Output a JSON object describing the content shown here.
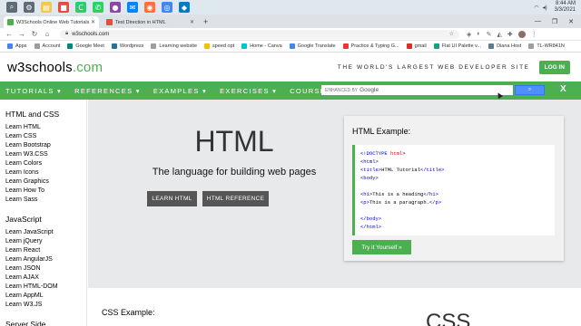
{
  "taskbar": {
    "apps": [
      {
        "icon": "search-icon",
        "color": "#5f6b76",
        "glyph": "⌕"
      },
      {
        "icon": "settings-icon",
        "color": "#5f6b76",
        "glyph": "⚙"
      },
      {
        "icon": "file-explorer-icon",
        "color": "#f2c94c",
        "glyph": "▤"
      },
      {
        "icon": "app-red-icon",
        "color": "#e74c3c",
        "glyph": "■"
      },
      {
        "icon": "app-green-icon",
        "color": "#2ecc71",
        "glyph": "C"
      },
      {
        "icon": "whatsapp-icon",
        "color": "#25d366",
        "glyph": "✆"
      },
      {
        "icon": "app-purple-icon",
        "color": "#8e44ad",
        "glyph": "●"
      },
      {
        "icon": "messenger-icon",
        "color": "#0084ff",
        "glyph": "✉"
      },
      {
        "icon": "firefox-icon",
        "color": "#ff7139",
        "glyph": "◉"
      },
      {
        "icon": "chrome-icon",
        "color": "#4285f4",
        "glyph": "◎"
      },
      {
        "icon": "vscode-icon",
        "color": "#007acc",
        "glyph": "◆"
      }
    ],
    "time": "8:44 AM",
    "date": "3/3/2021"
  },
  "browser": {
    "tabs": [
      {
        "title": "W3Schools Online Web Tutorials",
        "active": true,
        "favicon_color": "#4CAF50"
      },
      {
        "title": "Test Direction in HTML",
        "active": false,
        "favicon_color": "#e74c3c"
      }
    ],
    "new_tab": "+",
    "url": "w3schools.com",
    "bookmarks": [
      {
        "label": "Apps",
        "color": "#4285f4"
      },
      {
        "label": "Account",
        "color": "#9e9e9e"
      },
      {
        "label": "Google Meet",
        "color": "#00897b"
      },
      {
        "label": "Wordpress",
        "color": "#21759b"
      },
      {
        "label": "Learning website",
        "color": "#9e9e9e"
      },
      {
        "label": "speed opt",
        "color": "#fbbc05"
      },
      {
        "label": "Home - Canva",
        "color": "#00c4cc"
      },
      {
        "label": "Google Translate",
        "color": "#4285f4"
      },
      {
        "label": "Practice & Typing G...",
        "color": "#e53935"
      },
      {
        "label": "gmail",
        "color": "#d93025"
      },
      {
        "label": "Flat UI Palette v...",
        "color": "#16a085"
      },
      {
        "label": "Diana Host",
        "color": "#607d8b"
      },
      {
        "label": "TL-WR841N",
        "color": "#9e9e9e"
      }
    ]
  },
  "w3": {
    "logo_main": "w3schools",
    "logo_suffix": ".com",
    "tagline": "THE WORLD'S LARGEST WEB DEVELOPER SITE",
    "login": "LOG IN",
    "nav": [
      "TUTORIALS ▾",
      "REFERENCES ▾",
      "EXAMPLES ▾",
      "EXERCISES ▾",
      "COURSES"
    ],
    "search_prefix": "ENHANCED BY",
    "search_brand": "Google",
    "close": "X",
    "accent": "#4CAF50"
  },
  "sidebar": {
    "sections": [
      {
        "title": "HTML and CSS",
        "items": [
          "Learn HTML",
          "Learn CSS",
          "Learn Bootstrap",
          "Learn W3.CSS",
          "Learn Colors",
          "Learn Icons",
          "Learn Graphics",
          "Learn How To",
          "Learn Sass"
        ]
      },
      {
        "title": "JavaScript",
        "items": [
          "Learn JavaScript",
          "Learn jQuery",
          "Learn React",
          "Learn AngularJS",
          "Learn JSON",
          "Learn AJAX",
          "Learn HTML-DOM",
          "Learn AppML",
          "Learn W3.JS"
        ]
      },
      {
        "title": "Server Side",
        "items": []
      }
    ]
  },
  "hero": {
    "title": "HTML",
    "subtitle": "The language for building web pages",
    "btn_learn": "LEARN HTML",
    "btn_ref": "HTML REFERENCE",
    "example_title": "HTML Example:",
    "code": [
      [
        "<!DOCTYPE ",
        "html",
        ">"
      ],
      [
        "<html>"
      ],
      [
        "<title>",
        "HTML Tutorial",
        "</title>"
      ],
      [
        "<body>"
      ],
      [
        ""
      ],
      [
        "<h1>",
        "This is a heading",
        "</h1>"
      ],
      [
        "<p>",
        "This is a paragraph.",
        "</p>"
      ],
      [
        ""
      ],
      [
        "</body>"
      ],
      [
        "</html>"
      ]
    ],
    "try_it": "Try it Yourself »"
  },
  "css_section": {
    "example_title": "CSS Example:",
    "big_title": "CSS"
  }
}
